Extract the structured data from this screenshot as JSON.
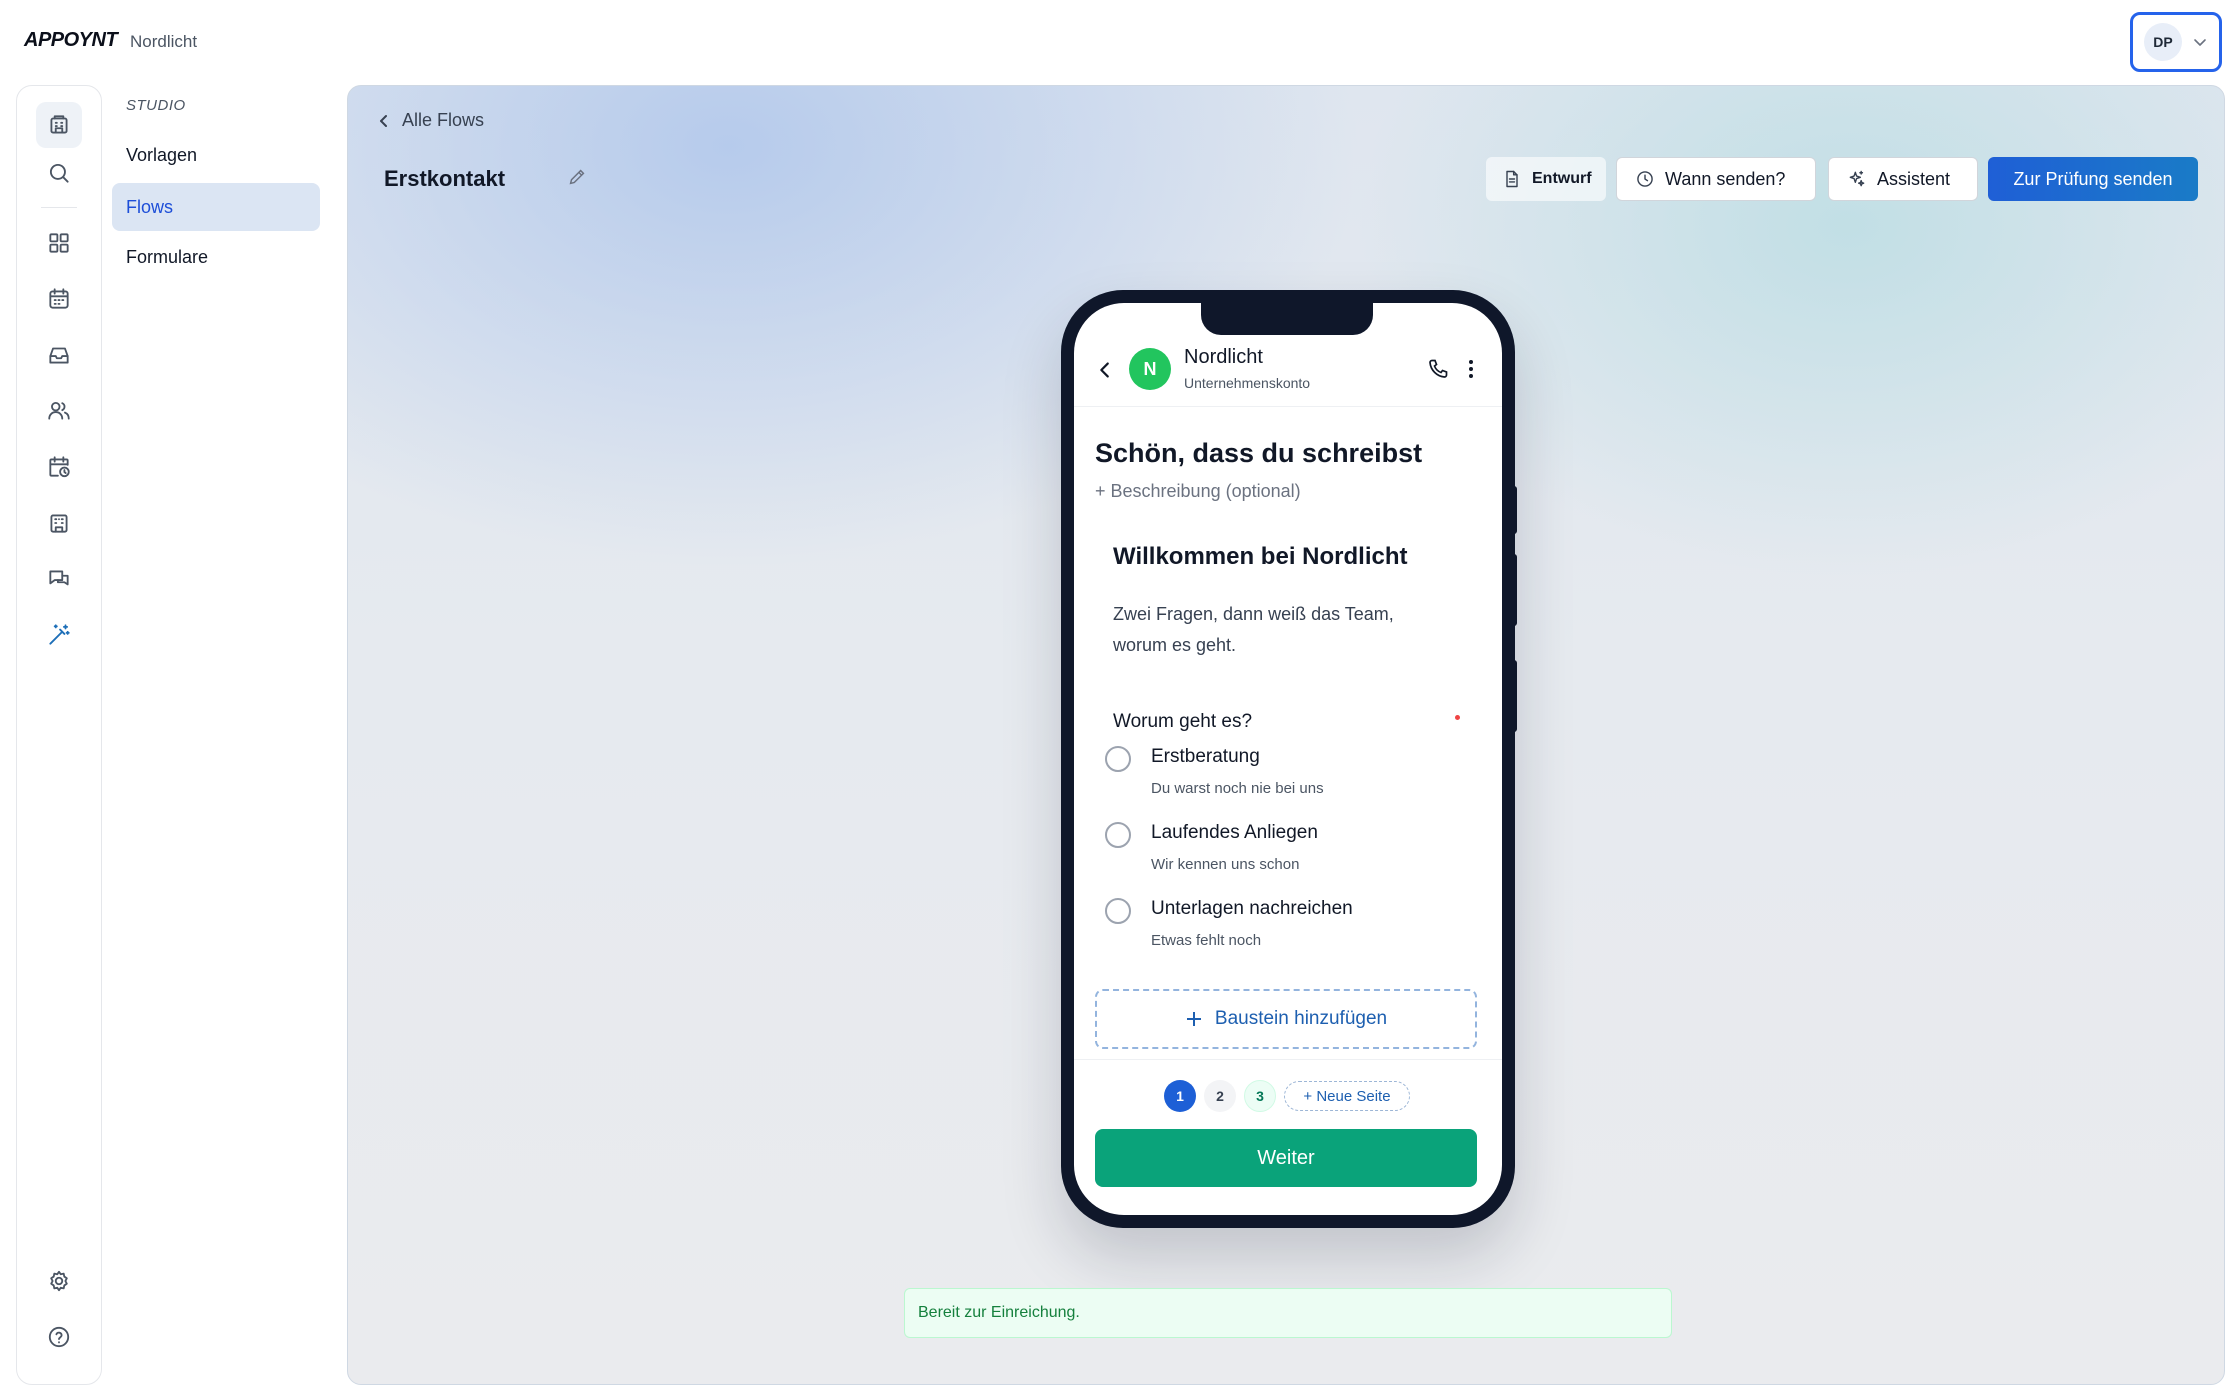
{
  "app": {
    "logo": "APPOYNT",
    "org": "Nordlicht"
  },
  "user": {
    "initials": "DP"
  },
  "rail": [
    {
      "icon": "building-icon"
    },
    {
      "icon": "search-icon"
    },
    {
      "icon": "dashboard-icon"
    },
    {
      "icon": "calendar-icon"
    },
    {
      "icon": "inbox-icon"
    },
    {
      "icon": "users-icon"
    },
    {
      "icon": "calendar-clock-icon"
    },
    {
      "icon": "office-icon"
    },
    {
      "icon": "chat-icon"
    },
    {
      "icon": "magic-wand-icon"
    },
    {
      "icon": "gear-icon"
    },
    {
      "icon": "help-icon"
    }
  ],
  "subnav": {
    "heading": "STUDIO",
    "items": [
      {
        "label": "Vorlagen"
      },
      {
        "label": "Flows",
        "active": true
      },
      {
        "label": "Formulare"
      }
    ]
  },
  "editor": {
    "back_label": "Alle Flows",
    "title": "Erstkontakt",
    "draft_label": "Entwurf",
    "when_label": "Wann senden?",
    "assistant_label": "Assistent",
    "submit_label": "Zur Prüfung senden"
  },
  "phone": {
    "business_name": "Nordlicht",
    "business_initial": "N",
    "business_type": "Unternehmenskonto",
    "form_title": "Schön, dass du schreibst",
    "form_description": "+ Beschreibung (optional)",
    "welcome_heading": "Willkommen bei Nordlicht",
    "intro_text": "Zwei Fragen, dann weiß das Team, worum es geht.",
    "question": "Worum geht es?",
    "options": [
      {
        "label": "Erstberatung",
        "sub": "Du warst noch nie bei uns"
      },
      {
        "label": "Laufendes Anliegen",
        "sub": "Wir kennen uns schon"
      },
      {
        "label": "Unterlagen nachreichen",
        "sub": "Etwas fehlt noch"
      }
    ],
    "add_block_label": "Baustein hinzufügen",
    "pages": [
      "1",
      "2",
      "3"
    ],
    "new_page_label": "+ Neue Seite",
    "continue_label": "Weiter"
  },
  "status": {
    "message": "Bereit zur Einreichung."
  },
  "colors": {
    "primary": "#1d5fd6",
    "success": "#0aa37a",
    "avatar_green": "#22c55e"
  }
}
